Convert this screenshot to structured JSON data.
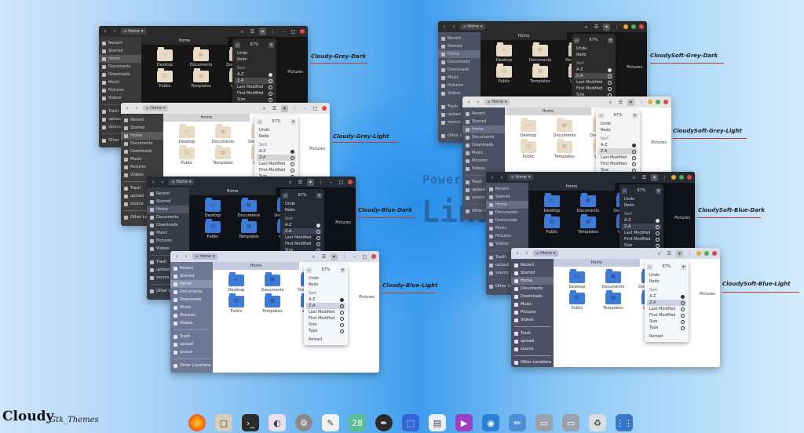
{
  "background": {
    "line1": "Power",
    "line2": "Linu"
  },
  "brand": {
    "title": "Cloudy",
    "subtitle": "Gtk_Themes"
  },
  "windows": [
    {
      "caption": "Cloudy-Grey-Dark",
      "path": "Home",
      "tab": "Home",
      "zoom": "67%"
    },
    {
      "caption": "Cloudy-Grey-Light",
      "path": "Home",
      "tab": "Home",
      "zoom": "67%"
    },
    {
      "caption": "Cloudy-Blue-Dark",
      "path": "Home",
      "tab": "Home",
      "zoom": "67%"
    },
    {
      "caption": "Cloudy-Blue-Light",
      "path": "Home",
      "tab": "Home",
      "zoom": "67%"
    },
    {
      "caption": "CloudySoft-Grey-Dark",
      "path": "Home",
      "tab": "Home",
      "zoom": "67%"
    },
    {
      "caption": "CloudySoft-Grey-Light",
      "path": "Home",
      "tab": "Home",
      "zoom": "67%"
    },
    {
      "caption": "CloudySoft-Blue-Dark",
      "path": "Home",
      "tab": "Home",
      "zoom": "67%"
    },
    {
      "caption": "CloudySoft-Blue-Light",
      "path": "Home",
      "tab": "Home",
      "zoom": "67%"
    }
  ],
  "sidebar": [
    "Recent",
    "Starred",
    "Home",
    "Documents",
    "Downloads",
    "Music",
    "Pictures",
    "Videos",
    "Trash",
    "upload",
    "source",
    "Other Locations"
  ],
  "files": [
    "Desktop",
    "Documents",
    "Downloads",
    "Public",
    "Templates",
    "Videos"
  ],
  "peek": "Pictures",
  "menu": {
    "undo": "Undo",
    "redo": "Redo",
    "sort": "Sort",
    "az": "A-Z",
    "za": "Z-A",
    "last": "Last Modified",
    "first": "First Modified",
    "size": "Size",
    "type": "Type",
    "reload": "Reload"
  },
  "colors": {
    "caption_line": "#c0392b",
    "folder_blue": "#3e7ad7",
    "folder_beige": "#e9dcc7"
  },
  "dock": [
    "firefox-icon",
    "files-icon",
    "terminal-icon",
    "toggle-icon",
    "settings-icon",
    "text-editor-icon",
    "calendar-icon",
    "inkscape-icon",
    "screenshot-icon",
    "document-viewer-icon",
    "video-icon",
    "camera-icon",
    "color-picker-icon",
    "drive-icon",
    "drive-icon",
    "trash-icon",
    "app-grid-icon"
  ],
  "dock_date": "28"
}
